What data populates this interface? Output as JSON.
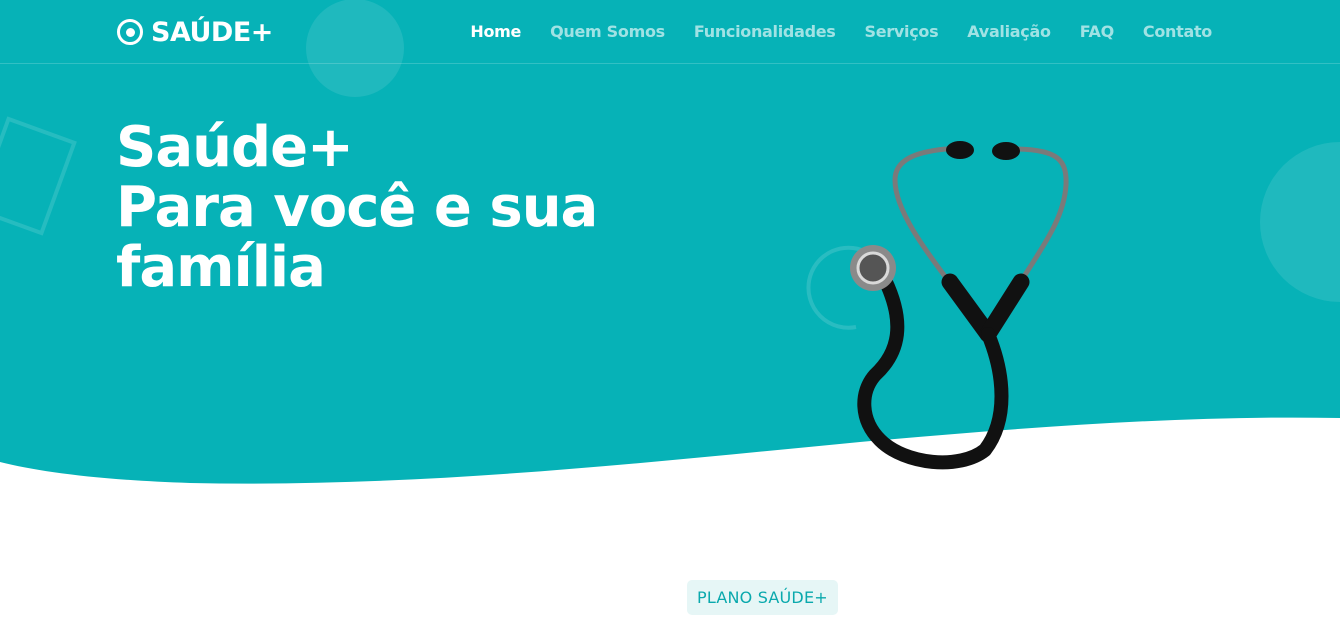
{
  "theme": {
    "primary": "#06b2b7",
    "white": "#ffffff",
    "pill_bg": "#e6f6f6",
    "pill_text": "#0aa9ad"
  },
  "header": {
    "brand": {
      "icon": "record-circle-icon",
      "name": "SAÚDE+"
    },
    "nav": [
      {
        "label": "Home",
        "active": true
      },
      {
        "label": "Quem Somos",
        "active": false
      },
      {
        "label": "Funcionalidades",
        "active": false
      },
      {
        "label": "Serviços",
        "active": false
      },
      {
        "label": "Avaliação",
        "active": false
      },
      {
        "label": "FAQ",
        "active": false
      },
      {
        "label": "Contato",
        "active": false
      }
    ]
  },
  "hero": {
    "title_lines": [
      "Saúde+",
      "Para você e sua",
      "família"
    ],
    "illustration": "stethoscope-icon"
  },
  "section": {
    "tag": "PLANO SAÚDE+"
  }
}
